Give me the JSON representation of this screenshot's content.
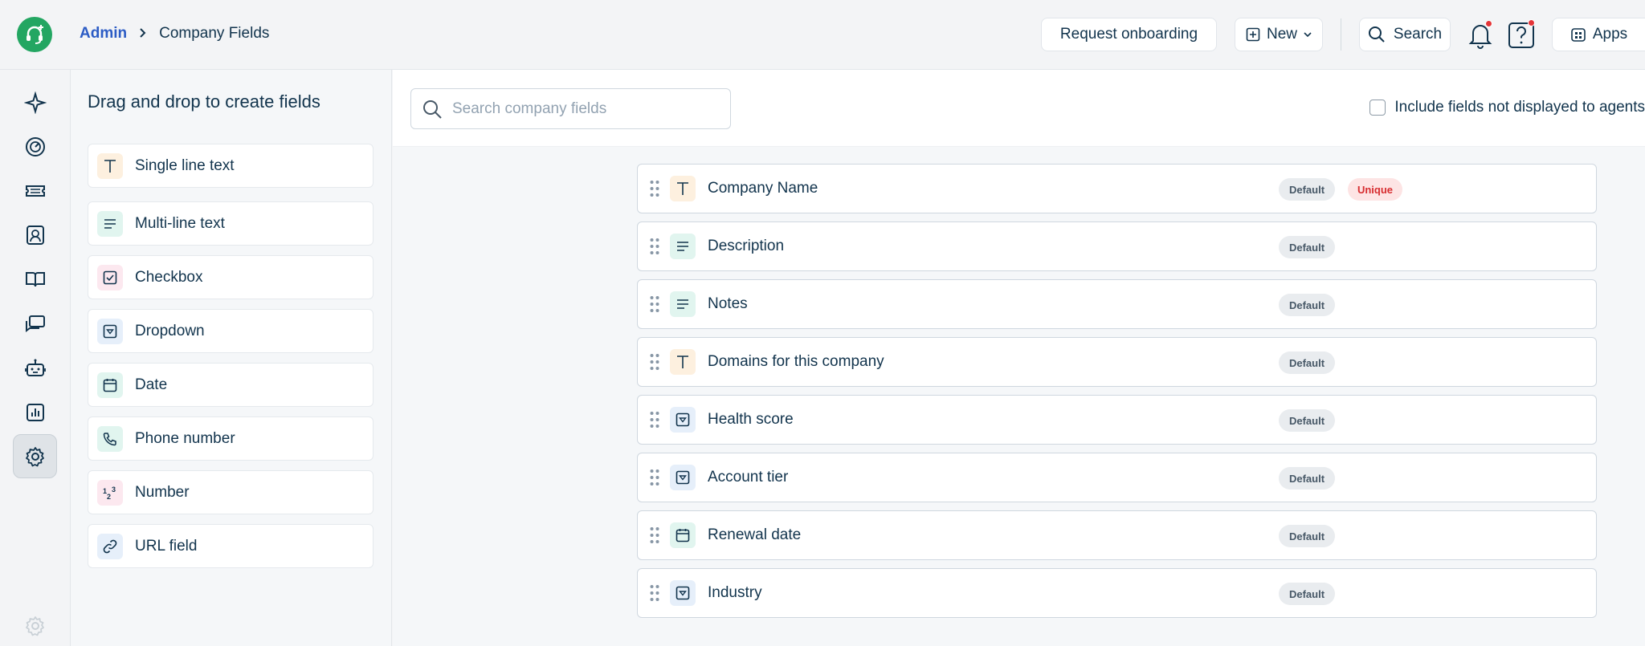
{
  "header": {
    "breadcrumb_root": "Admin",
    "breadcrumb_current": "Company Fields",
    "request_onboarding": "Request onboarding",
    "new_label": "New",
    "search_label": "Search",
    "apps_label": "Apps"
  },
  "rail": {
    "items": [
      "sparkle-icon",
      "speedometer-icon",
      "ticket-icon",
      "contact-icon",
      "book-icon",
      "chat-icon",
      "bot-icon",
      "chart-icon",
      "gear-icon"
    ],
    "active": "gear-icon"
  },
  "palette": {
    "title": "Drag and drop to create fields",
    "items": [
      {
        "label": "Single line text",
        "icon": "text-icon"
      },
      {
        "label": "Multi-line text",
        "icon": "lines-icon"
      },
      {
        "label": "Checkbox",
        "icon": "checkbox-icon"
      },
      {
        "label": "Dropdown",
        "icon": "dropdown-icon"
      },
      {
        "label": "Date",
        "icon": "calendar-icon"
      },
      {
        "label": "Phone number",
        "icon": "phone-icon"
      },
      {
        "label": "Number",
        "icon": "number-icon"
      },
      {
        "label": "URL field",
        "icon": "link-icon"
      }
    ]
  },
  "search": {
    "placeholder": "Search company fields",
    "include_label": "Include fields not displayed to agents"
  },
  "fields": [
    {
      "label": "Company Name",
      "icon": "text-icon",
      "badges": [
        "Default",
        "Unique"
      ]
    },
    {
      "label": "Description",
      "icon": "lines-icon",
      "badges": [
        "Default"
      ]
    },
    {
      "label": "Notes",
      "icon": "lines-icon",
      "badges": [
        "Default"
      ]
    },
    {
      "label": "Domains for this company",
      "icon": "text-icon",
      "badges": [
        "Default"
      ]
    },
    {
      "label": "Health score",
      "icon": "dropdown-icon",
      "badges": [
        "Default"
      ]
    },
    {
      "label": "Account tier",
      "icon": "dropdown-icon",
      "badges": [
        "Default"
      ]
    },
    {
      "label": "Renewal date",
      "icon": "calendar-icon",
      "badges": [
        "Default"
      ]
    },
    {
      "label": "Industry",
      "icon": "dropdown-icon",
      "badges": [
        "Default"
      ]
    }
  ],
  "colors": {
    "brand": "#23a662",
    "link": "#2c5cc5",
    "notification": "#e43538",
    "unique_badge": "#d72d30"
  }
}
